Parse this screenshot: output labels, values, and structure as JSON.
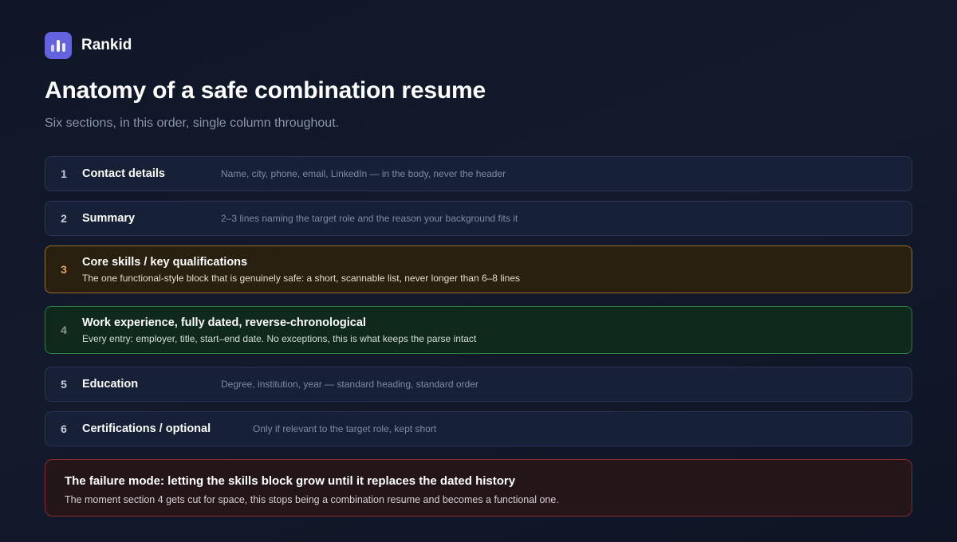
{
  "brand": {
    "name": "Rankid",
    "logo_icon": "bar-chart-icon",
    "accent": "#6462df"
  },
  "title": "Anatomy of a safe combination resume",
  "subtitle": "Six sections, in this order, single column throughout.",
  "sections": [
    {
      "num": "1",
      "label": "Contact details",
      "desc": "Name, city, phone, email, LinkedIn — in the body, never the header"
    },
    {
      "num": "2",
      "label": "Summary",
      "desc": "2–3 lines naming the target role and the reason your background fits it"
    },
    {
      "num": "3",
      "label": "Core skills / key qualifications",
      "desc": "The one functional-style block that is genuinely safe: a short, scannable list, never longer than 6–8 lines",
      "highlight": "#9a6a26"
    },
    {
      "num": "4",
      "label": "Work experience, fully dated, reverse-chronological",
      "desc": "Every entry: employer, title, start–end date. No exceptions, this is what keeps the parse intact",
      "highlight": "#2a7b46"
    },
    {
      "num": "5",
      "label": "Education",
      "desc": "Degree, institution, year — standard heading, standard order"
    },
    {
      "num": "6",
      "label": "Certifications / optional",
      "desc": "Only if relevant to the target role, kept short"
    }
  ],
  "callout": {
    "title": "The failure mode: letting the skills block grow until it replaces the dated history",
    "desc": "The moment section 4 gets cut for space, this stops being a combination resume and becomes a functional one.",
    "color": "#8a2a2e"
  }
}
